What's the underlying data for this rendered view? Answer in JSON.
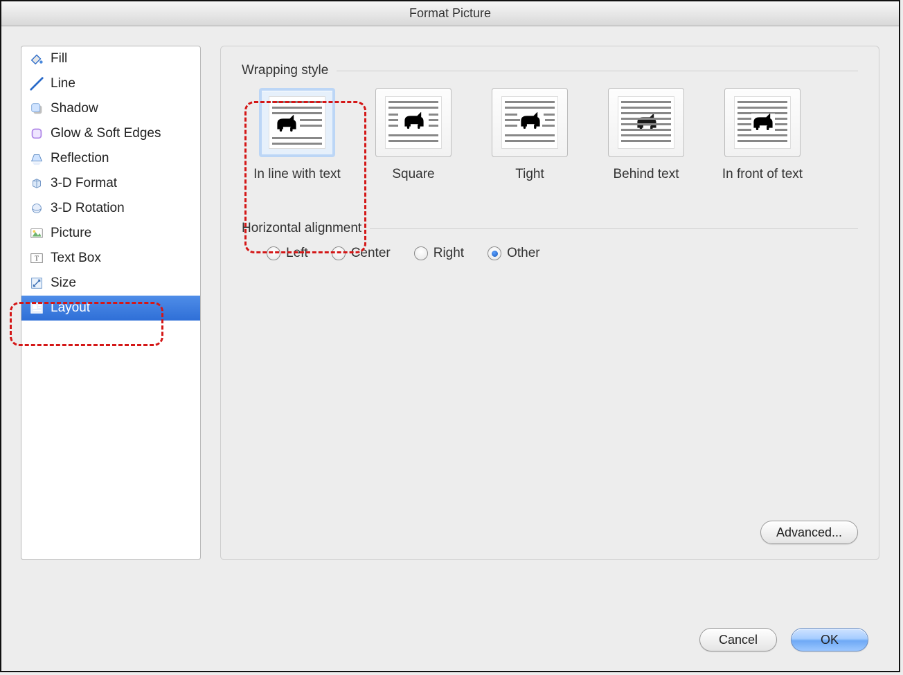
{
  "window": {
    "title": "Format Picture"
  },
  "sidebar": {
    "items": [
      {
        "label": "Fill"
      },
      {
        "label": "Line"
      },
      {
        "label": "Shadow"
      },
      {
        "label": "Glow & Soft Edges"
      },
      {
        "label": "Reflection"
      },
      {
        "label": "3-D Format"
      },
      {
        "label": "3-D Rotation"
      },
      {
        "label": "Picture"
      },
      {
        "label": "Text Box"
      },
      {
        "label": "Size"
      },
      {
        "label": "Layout"
      }
    ],
    "selected_index": 10
  },
  "sections": {
    "wrapping_label": "Wrapping style",
    "alignment_label": "Horizontal alignment"
  },
  "wrapping": {
    "options": [
      {
        "label": "In line with text"
      },
      {
        "label": "Square"
      },
      {
        "label": "Tight"
      },
      {
        "label": "Behind text"
      },
      {
        "label": "In front of text"
      }
    ],
    "selected_index": 0
  },
  "alignment": {
    "options": [
      {
        "label": "Left"
      },
      {
        "label": "Center"
      },
      {
        "label": "Right"
      },
      {
        "label": "Other"
      }
    ],
    "selected_index": 3
  },
  "buttons": {
    "advanced": "Advanced...",
    "cancel": "Cancel",
    "ok": "OK"
  }
}
